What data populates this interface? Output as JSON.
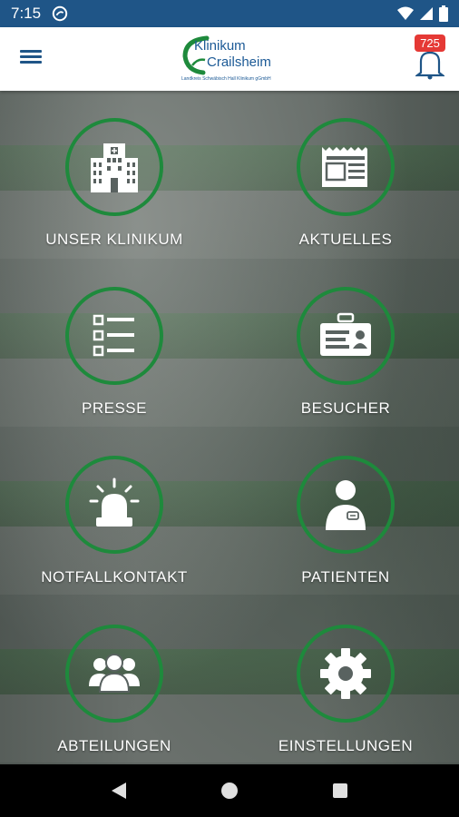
{
  "status_bar": {
    "time": "7:15"
  },
  "app_bar": {
    "logo_line1": "Klinikum",
    "logo_line2": "Crailsheim",
    "logo_sub": "Landkreis Schwäbisch Hall Klinikum gGmbH",
    "notification_count": "725"
  },
  "tiles": [
    {
      "label": "UNSER KLINIKUM",
      "icon": "hospital-icon"
    },
    {
      "label": "AKTUELLES",
      "icon": "newspaper-icon"
    },
    {
      "label": "PRESSE",
      "icon": "list-icon"
    },
    {
      "label": "BESUCHER",
      "icon": "id-card-icon"
    },
    {
      "label": "NOTFALLKONTAKT",
      "icon": "siren-icon"
    },
    {
      "label": "PATIENTEN",
      "icon": "patient-icon"
    },
    {
      "label": "ABTEILUNGEN",
      "icon": "group-icon"
    },
    {
      "label": "EINSTELLUNGEN",
      "icon": "gear-icon"
    }
  ],
  "colors": {
    "status_bar": "#1f5587",
    "accent_green": "#1e8a3c",
    "badge": "#e53935"
  }
}
